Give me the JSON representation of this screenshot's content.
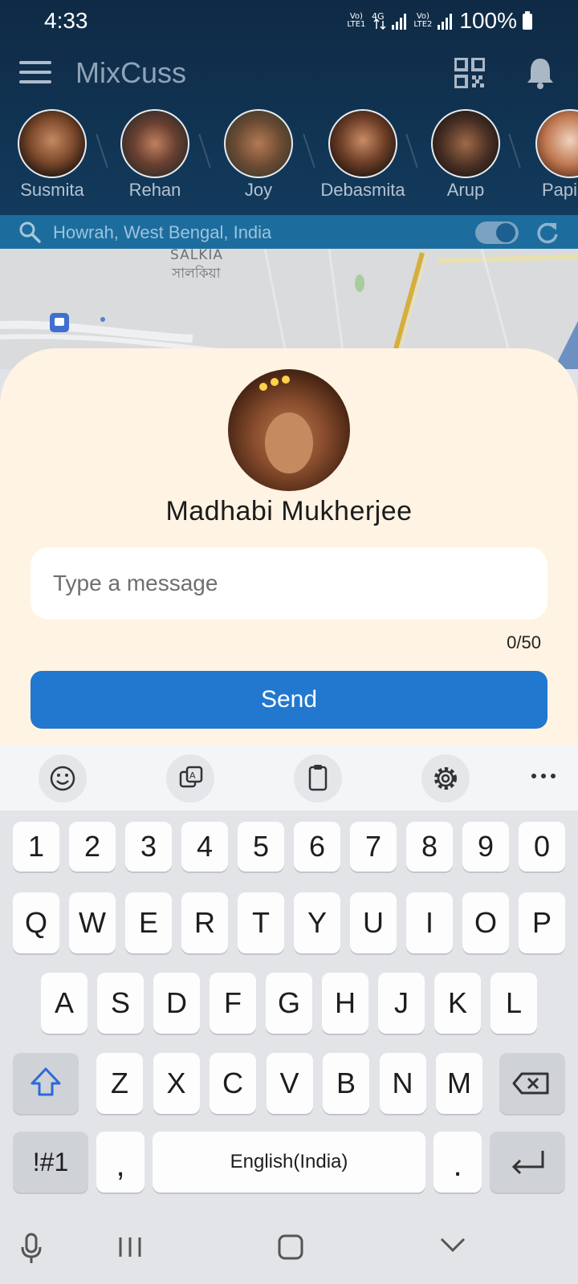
{
  "status_bar": {
    "time": "4:33",
    "battery": "100%",
    "net1": "Vo) 4G LTE1",
    "net2": "Vo) R LTE2"
  },
  "app": {
    "title": "MixCuss"
  },
  "stories": [
    {
      "name": "Susmita"
    },
    {
      "name": "Rehan"
    },
    {
      "name": "Joy"
    },
    {
      "name": "Debasmita"
    },
    {
      "name": "Arup"
    },
    {
      "name": "Papi"
    }
  ],
  "search": {
    "location": "Howrah, West Bengal, India",
    "toggle_on": true
  },
  "map": {
    "label_en": "SALKIA",
    "label_bn": "সালকিয়া"
  },
  "sheet": {
    "name": "Madhabi Mukherjee",
    "message_placeholder": "Type a message",
    "counter": "0/50",
    "send_label": "Send"
  },
  "keyboard": {
    "row_numbers": [
      "1",
      "2",
      "3",
      "4",
      "5",
      "6",
      "7",
      "8",
      "9",
      "0"
    ],
    "row_q": [
      "Q",
      "W",
      "E",
      "R",
      "T",
      "Y",
      "U",
      "I",
      "O",
      "P"
    ],
    "row_a": [
      "A",
      "S",
      "D",
      "F",
      "G",
      "H",
      "J",
      "K",
      "L"
    ],
    "row_z": [
      "Z",
      "X",
      "C",
      "V",
      "B",
      "N",
      "M"
    ],
    "symbols_label": "!#1",
    "comma": ",",
    "space_label": "English(India)",
    "period": "."
  },
  "colors": {
    "header": "#0f2a45",
    "accent": "#2278cf",
    "sheet": "#fff3e3",
    "search_bar": "#1c6d9e"
  }
}
